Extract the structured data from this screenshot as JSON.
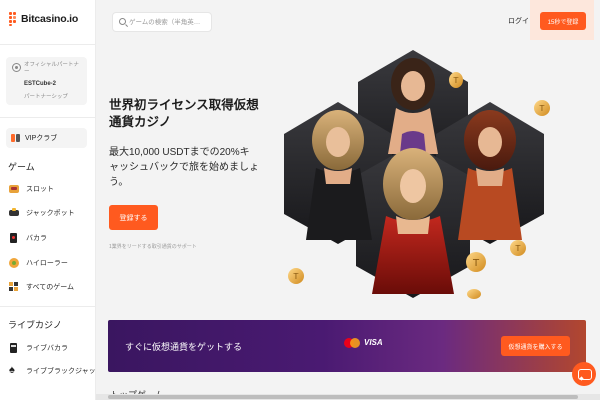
{
  "brand": {
    "name": "Bitcasino.io",
    "accent": "#ff5a1f"
  },
  "sidebar": {
    "partner": {
      "label": "オフィシャルパートナー",
      "name": "ESTCube-2",
      "sub": "パートナーシップ"
    },
    "vip_label": "VIPクラブ",
    "games_title": "ゲーム",
    "games": [
      {
        "label": "スロット",
        "icon": "slot-icon"
      },
      {
        "label": "ジャックポット",
        "icon": "jackpot-icon"
      },
      {
        "label": "バカラ",
        "icon": "baccarat-icon"
      },
      {
        "label": "ハイローラー",
        "icon": "highroller-icon"
      },
      {
        "label": "すべてのゲーム",
        "icon": "all-games-icon"
      }
    ],
    "live_title": "ライブカジノ",
    "live": [
      {
        "label": "ライブバカラ",
        "icon": "live-baccarat-icon"
      },
      {
        "label": "ライブブラックジャック",
        "icon": "spade-icon"
      }
    ]
  },
  "header": {
    "search_placeholder": "ゲームの検索（半角英…",
    "login": "ログイン",
    "signup": "15秒で登録"
  },
  "hero": {
    "title": "世界初ライセンス取得仮想通貨カジノ",
    "subtitle": "最大10,000 USDTまでの20%キャッシュバックで旅を始めましょう。",
    "button": "登録する",
    "note": "1業界をリードする取引通貨のサポート"
  },
  "banner": {
    "text": "すぐに仮想通貨をゲットする",
    "payment_icons": [
      "mastercard-icon",
      "visa-icon"
    ],
    "visa": "VISA",
    "button": "仮想通貨を購入する"
  },
  "bottom_peek": "トップゲーム"
}
